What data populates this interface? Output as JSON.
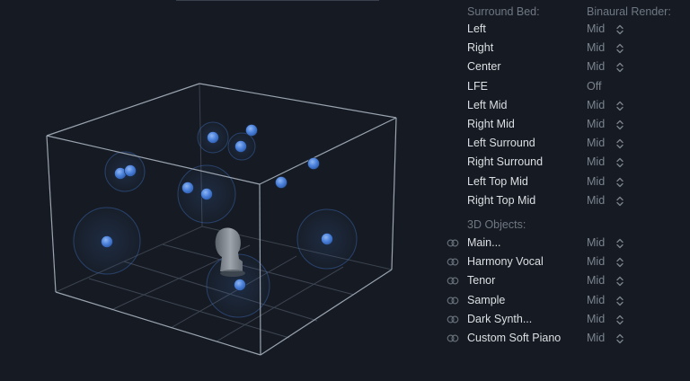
{
  "surround_bed": {
    "header": "Surround Bed:",
    "render_header": "Binaural Render:",
    "items": [
      {
        "label": "Left",
        "value": "Mid",
        "adjustable": true
      },
      {
        "label": "Right",
        "value": "Mid",
        "adjustable": true
      },
      {
        "label": "Center",
        "value": "Mid",
        "adjustable": true
      },
      {
        "label": "LFE",
        "value": "Off",
        "adjustable": false
      },
      {
        "label": "Left Mid",
        "value": "Mid",
        "adjustable": true
      },
      {
        "label": "Right Mid",
        "value": "Mid",
        "adjustable": true
      },
      {
        "label": "Left Surround",
        "value": "Mid",
        "adjustable": true
      },
      {
        "label": "Right Surround",
        "value": "Mid",
        "adjustable": true
      },
      {
        "label": "Left Top Mid",
        "value": "Mid",
        "adjustable": true
      },
      {
        "label": "Right Top Mid",
        "value": "Mid",
        "adjustable": true
      }
    ]
  },
  "objects": {
    "header": "3D Objects:",
    "items": [
      {
        "label": "Main...",
        "value": "Mid"
      },
      {
        "label": "Harmony Vocal",
        "value": "Mid"
      },
      {
        "label": "Tenor",
        "value": "Mid"
      },
      {
        "label": "Sample",
        "value": "Mid"
      },
      {
        "label": "Dark Synth...",
        "value": "Mid"
      },
      {
        "label": "Custom Soft Piano",
        "value": "Mid"
      }
    ]
  },
  "colors": {
    "background": "#161b23",
    "sound_object": "#4c82dc",
    "room_edge": "#9aa3af",
    "label": "#dcdfe3",
    "muted": "#7b838d"
  },
  "icons": {
    "stepper": "up-down-chevron-icon",
    "object_link": "link-rings-icon",
    "listener": "listener-head-icon"
  }
}
